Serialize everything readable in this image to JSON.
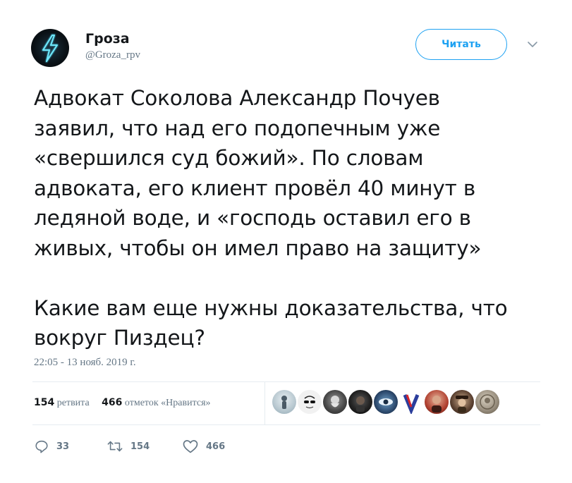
{
  "account": {
    "name": "Гроза",
    "handle": "@Groza_rpv"
  },
  "follow_button": {
    "label": "Читать"
  },
  "tweet": {
    "text": "Адвокат Соколова Александр Почуев\nзаявил, что над его подопечным уже\n«свершился суд божий». По словам\nадвоката, его клиент провёл 40 минут в\nледяной воде, и «господь оставил его в\nживых, чтобы он имел право на защиту»\n\nКакие вам еще нужны доказательства, что\nвокруг Пиздец?",
    "timestamp": "22:05 - 13 нояб. 2019 г."
  },
  "stats": {
    "retweets_count": "154",
    "retweets_label": "ретвита",
    "likes_count": "466",
    "likes_label": "отметок «Нравится»"
  },
  "likers": [
    {
      "icon": "avatar-figure",
      "color": "#8fa6b2"
    },
    {
      "icon": "avatar-sunglasses",
      "color": "#e8e8e8"
    },
    {
      "icon": "avatar-bearded",
      "color": "#3a3a3a"
    },
    {
      "icon": "avatar-dark",
      "color": "#1a1a1a"
    },
    {
      "icon": "avatar-eye",
      "color": "#2d4a6e"
    },
    {
      "icon": "avatar-v-letter",
      "color": "#ffffff"
    },
    {
      "icon": "avatar-portrait",
      "color": "#b04030"
    },
    {
      "icon": "avatar-hat",
      "color": "#5a4030"
    },
    {
      "icon": "avatar-coin",
      "color": "#7a7060"
    }
  ],
  "actions": {
    "replies": "33",
    "retweets": "154",
    "likes": "466"
  },
  "colors": {
    "accent": "#1da1f2",
    "secondary_text": "#657786",
    "primary_text": "#14171a",
    "divider": "#e6ecf0"
  }
}
